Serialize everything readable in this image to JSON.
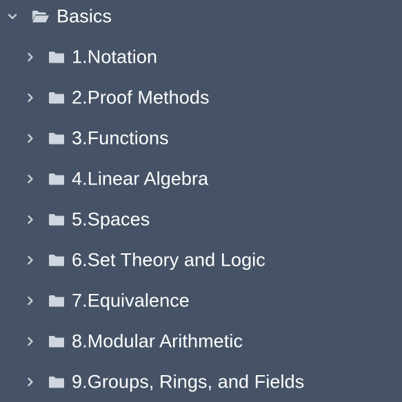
{
  "colors": {
    "background": "#465366",
    "text": "#ffffff",
    "icon": "#cfd6df",
    "chevron": "#c7cdd6"
  },
  "tree": {
    "root": {
      "label": "Basics",
      "expanded": true,
      "icon": "folder-open-icon"
    },
    "children": [
      {
        "label": "1.Notation",
        "expanded": false,
        "icon": "folder-icon"
      },
      {
        "label": "2.Proof Methods",
        "expanded": false,
        "icon": "folder-icon"
      },
      {
        "label": "3.Functions",
        "expanded": false,
        "icon": "folder-icon"
      },
      {
        "label": "4.Linear Algebra",
        "expanded": false,
        "icon": "folder-icon"
      },
      {
        "label": "5.Spaces",
        "expanded": false,
        "icon": "folder-icon"
      },
      {
        "label": "6.Set Theory and Logic",
        "expanded": false,
        "icon": "folder-icon"
      },
      {
        "label": "7.Equivalence",
        "expanded": false,
        "icon": "folder-icon"
      },
      {
        "label": "8.Modular Arithmetic",
        "expanded": false,
        "icon": "folder-icon"
      },
      {
        "label": "9.Groups, Rings, and Fields",
        "expanded": false,
        "icon": "folder-icon"
      }
    ]
  }
}
